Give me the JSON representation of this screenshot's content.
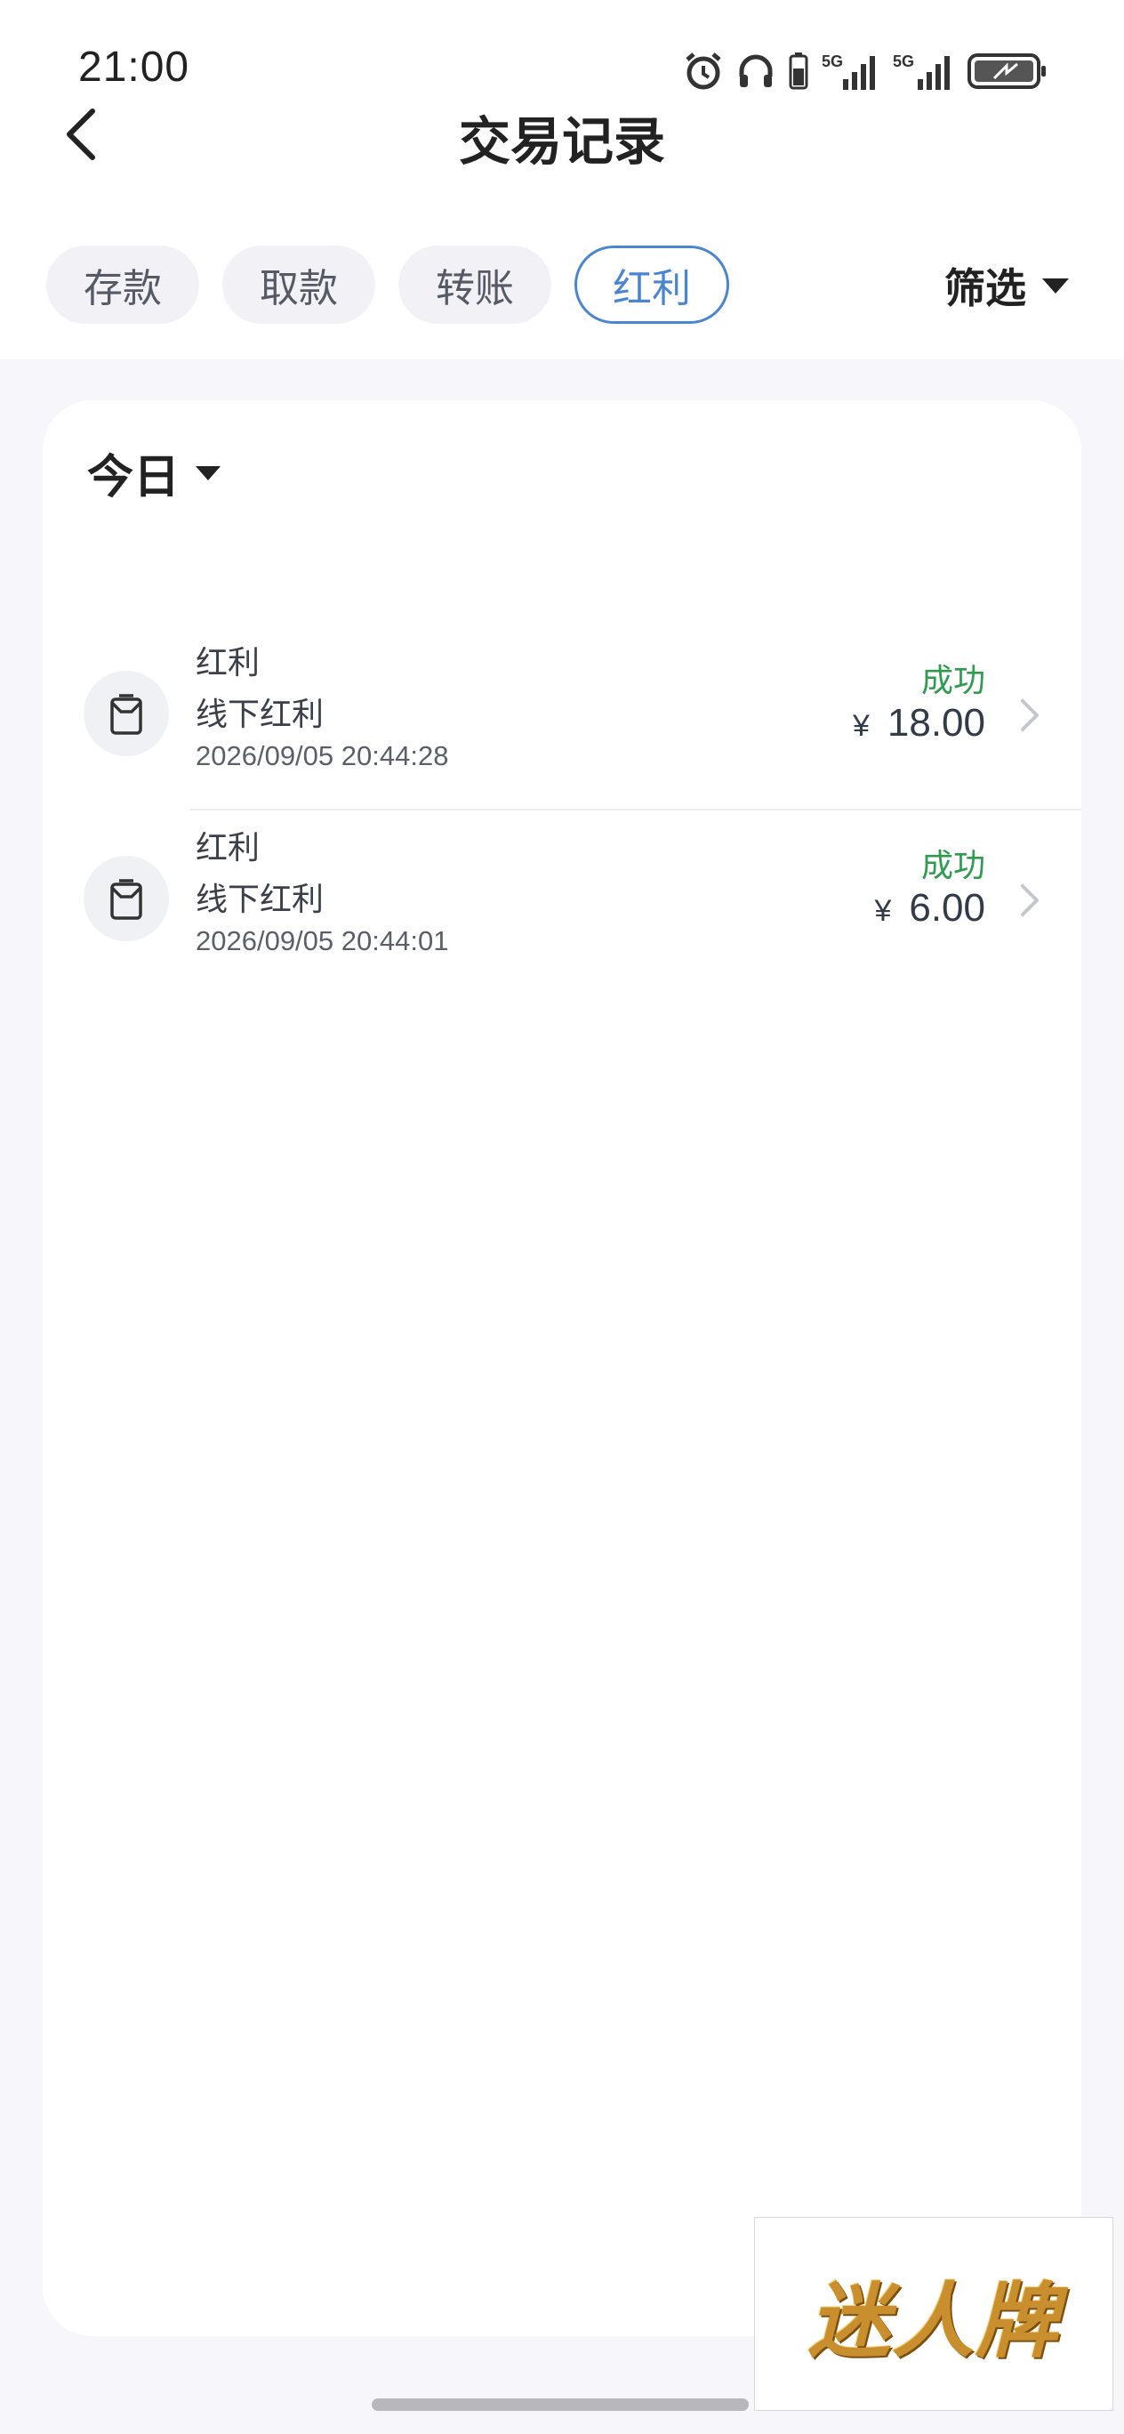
{
  "status_bar": {
    "time": "21:00",
    "icons": [
      "alarm-icon",
      "headphones-icon",
      "battery-small-icon",
      "signal-5g-icon",
      "signal-5g-icon",
      "battery-charging-icon"
    ],
    "network_label_1": "5G",
    "network_label_2": "5G"
  },
  "header": {
    "title": "交易记录",
    "back_icon": "chevron-left-icon"
  },
  "tabs": [
    {
      "label": "存款",
      "active": false
    },
    {
      "label": "取款",
      "active": false
    },
    {
      "label": "转账",
      "active": false
    },
    {
      "label": "红利",
      "active": true
    }
  ],
  "filter": {
    "label": "筛选"
  },
  "date_filter": {
    "label": "今日"
  },
  "transactions": [
    {
      "type": "红利",
      "description": "线下红利",
      "time": "2026/09/05 20:44:28",
      "status": "成功",
      "currency": "¥",
      "amount": "18.00"
    },
    {
      "type": "红利",
      "description": "线下红利",
      "time": "2026/09/05 20:44:01",
      "status": "成功",
      "currency": "¥",
      "amount": "6.00"
    }
  ],
  "watermark": {
    "text": "迷人牌"
  },
  "colors": {
    "accent": "#4a86cf",
    "success": "#2e9b4e",
    "background": "#f7f7fb"
  }
}
